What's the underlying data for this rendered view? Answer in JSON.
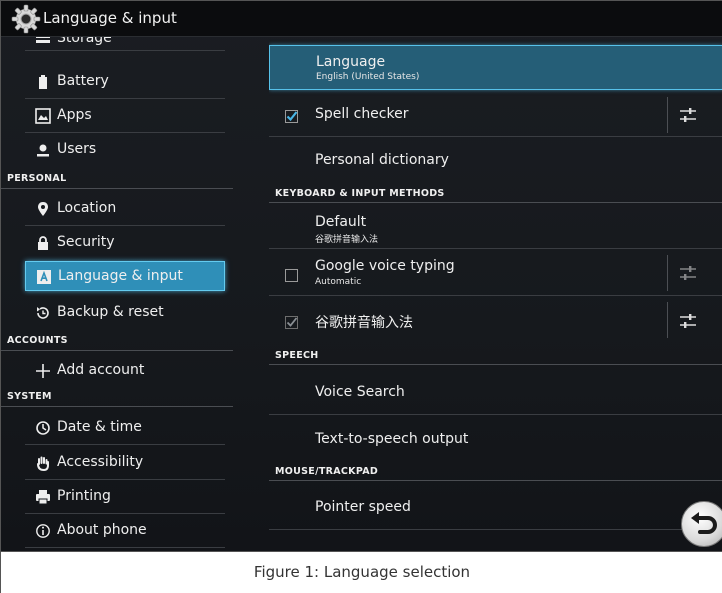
{
  "window": {
    "title": "Language & input"
  },
  "left_pane": {
    "items": [
      {
        "label": "Storage",
        "icon": "storage-icon"
      },
      {
        "label": "Battery",
        "icon": "battery-icon"
      },
      {
        "label": "Apps",
        "icon": "apps-icon"
      },
      {
        "label": "Users",
        "icon": "users-icon"
      }
    ],
    "personal": {
      "header": "PERSONAL",
      "items": [
        {
          "label": "Location",
          "icon": "location-pin-icon"
        },
        {
          "label": "Security",
          "icon": "lock-icon"
        },
        {
          "label": "Language & input",
          "icon": "keyboard-a-icon",
          "selected": true
        },
        {
          "label": "Backup & reset",
          "icon": "backup-reset-icon"
        }
      ]
    },
    "accounts": {
      "header": "ACCOUNTS",
      "items": [
        {
          "label": "Add account",
          "icon": "plus-icon"
        }
      ]
    },
    "system": {
      "header": "SYSTEM",
      "items": [
        {
          "label": "Date & time",
          "icon": "clock-icon"
        },
        {
          "label": "Accessibility",
          "icon": "hand-icon"
        },
        {
          "label": "Printing",
          "icon": "printer-icon"
        },
        {
          "label": "About phone",
          "icon": "info-icon"
        }
      ]
    }
  },
  "right_pane": {
    "language": {
      "title": "Language",
      "summary": "English (United States)"
    },
    "spell_checker": {
      "title": "Spell checker",
      "checked": true
    },
    "personal_dictionary": {
      "title": "Personal dictionary"
    },
    "keyboard_header": "KEYBOARD & INPUT METHODS",
    "default": {
      "title": "Default",
      "summary": "谷歌拼音输入法"
    },
    "google_voice": {
      "title": "Google voice typing",
      "summary": "Automatic",
      "checked": false
    },
    "pinyin": {
      "title": "谷歌拼音输入法",
      "checked": true
    },
    "speech_header": "SPEECH",
    "voice_search": {
      "title": "Voice Search"
    },
    "tts": {
      "title": "Text-to-speech output"
    },
    "mouse_header": "MOUSE/TRACKPAD",
    "pointer_speed": {
      "title": "Pointer speed"
    }
  },
  "caption": "Figure 1: Language selection",
  "colors": {
    "accent": "#2f8fb8",
    "accent_border": "#64cbef",
    "background": "#16191d",
    "action_bar": "#0b0c0e",
    "text": "#efefef"
  }
}
